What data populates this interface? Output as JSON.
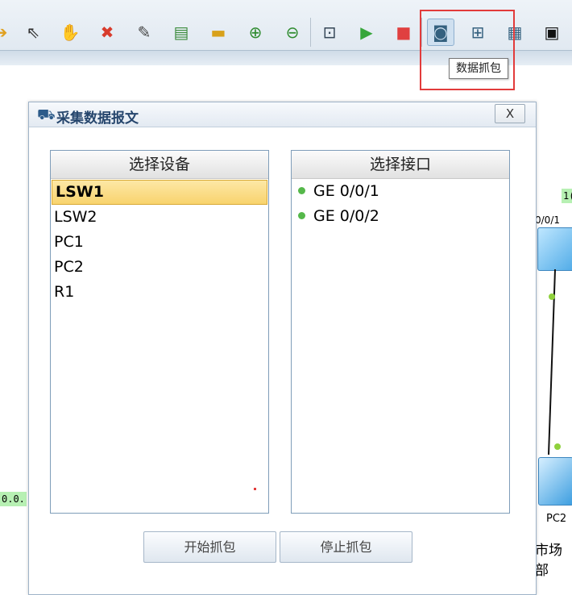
{
  "toolbar": {
    "tooltip": "数据抓包",
    "icons": [
      "arrow-icon",
      "pointer-icon",
      "hand-icon",
      "delete-icon",
      "erase-icon",
      "note-icon",
      "rectangle-icon",
      "zoom-in-icon",
      "zoom-out-icon",
      "fit-icon",
      "start-icon",
      "stop-icon",
      "capture-icon",
      "topology-icon",
      "table-icon",
      "screenshot-icon"
    ]
  },
  "background": {
    "port_label": "0/0/1",
    "device_label": "PC2",
    "zone_label": "市场部",
    "tag_left": "0.0.",
    "tag_right": "1("
  },
  "dialog": {
    "title": "采集数据报文",
    "close_label": "X",
    "devices_header": "选择设备",
    "devices": [
      "LSW1",
      "LSW2",
      "PC1",
      "PC2",
      "R1"
    ],
    "selected_device": "LSW1",
    "interfaces_header": "选择接口",
    "interfaces": [
      "GE 0/0/1",
      "GE 0/0/2"
    ],
    "start_button": "开始抓包",
    "stop_button": "停止抓包"
  },
  "colors": {
    "highlight": "#e23b3b",
    "title": "#26466d",
    "status_green": "#55b84a"
  }
}
